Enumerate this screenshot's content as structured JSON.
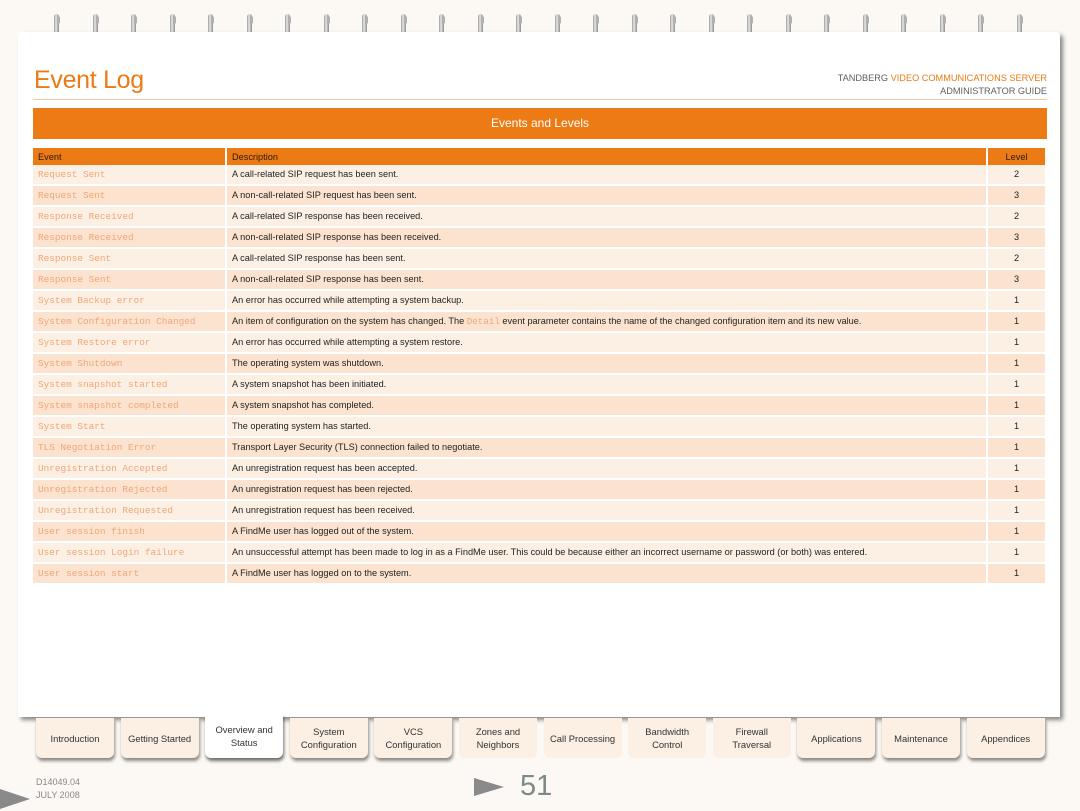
{
  "header": {
    "title": "Event Log",
    "brand_prefix": "TANDBERG ",
    "brand_highlight": "VIDEO COMMUNICATIONS SERVER",
    "guide": "ADMINISTRATOR GUIDE"
  },
  "section": {
    "title": "Events and Levels"
  },
  "table": {
    "columns": [
      "Event",
      "Description",
      "Level"
    ],
    "rows": [
      {
        "event": "Request Sent",
        "description": "A call-related SIP request has been sent.",
        "level": "2"
      },
      {
        "event": "Request Sent",
        "description": "A non-call-related SIP request has been sent.",
        "level": "3"
      },
      {
        "event": "Response Received",
        "description": "A call-related SIP response has been received.",
        "level": "2"
      },
      {
        "event": "Response Received",
        "description": "A non-call-related SIP response has been received.",
        "level": "3"
      },
      {
        "event": "Response Sent",
        "description": "A call-related SIP response has been sent.",
        "level": "2"
      },
      {
        "event": "Response Sent",
        "description": "A non-call-related SIP response has been sent.",
        "level": "3"
      },
      {
        "event": "System Backup error",
        "description": "An error has occurred while attempting a system backup.",
        "level": "1"
      },
      {
        "event": "System Configuration Changed",
        "description_pre": "An item of configuration on the system has changed.  The ",
        "description_code": "Detail",
        "description_post": " event parameter contains the name of the changed configuration item and its new value.",
        "level": "1"
      },
      {
        "event": "System Restore error",
        "description": "An error has occurred while attempting a system restore.",
        "level": "1"
      },
      {
        "event": "System Shutdown",
        "description": "The operating system was shutdown.",
        "level": "1"
      },
      {
        "event": "System snapshot started",
        "description": "A system snapshot has been initiated.",
        "level": "1"
      },
      {
        "event": "System snapshot completed",
        "description": "A system snapshot has completed.",
        "level": "1"
      },
      {
        "event": "System Start",
        "description": "The operating system has started.",
        "level": "1"
      },
      {
        "event": "TLS Negotiation Error",
        "description": "Transport Layer Security (TLS) connection failed to negotiate.",
        "level": "1"
      },
      {
        "event": "Unregistration Accepted",
        "description": "An unregistration request has been accepted.",
        "level": "1"
      },
      {
        "event": "Unregistration Rejected",
        "description": "An unregistration request has been rejected.",
        "level": "1"
      },
      {
        "event": "Unregistration Requested",
        "description": "An unregistration request has been received.",
        "level": "1"
      },
      {
        "event": "User session finish",
        "description": "A FindMe user has logged out of the system.",
        "level": "1"
      },
      {
        "event": "User session Login failure",
        "description": "An unsuccessful attempt has been made to log in as a FindMe user.  This could be because either an incorrect username or password (or both) was entered.",
        "level": "1"
      },
      {
        "event": "User session start",
        "description": "A FindMe user has logged on to the system.",
        "level": "1"
      }
    ]
  },
  "nav_tabs": [
    {
      "label": "Introduction",
      "active": false
    },
    {
      "label": "Getting Started",
      "active": false
    },
    {
      "label": "Overview and Status",
      "active": true
    },
    {
      "label": "System Configuration",
      "active": false
    },
    {
      "label": "VCS Configuration",
      "active": false
    },
    {
      "label": "Zones and Neighbors",
      "active": false
    },
    {
      "label": "Call Processing",
      "active": false
    },
    {
      "label": "Bandwidth Control",
      "active": false
    },
    {
      "label": "Firewall Traversal",
      "active": false
    },
    {
      "label": "Applications",
      "active": false
    },
    {
      "label": "Maintenance",
      "active": false
    },
    {
      "label": "Appendices",
      "active": false
    }
  ],
  "footer": {
    "doc_id": "D14049.04",
    "date": "JULY 2008",
    "page_number": "51"
  },
  "colors": {
    "accent": "#ec7b16",
    "event_name": "#f0a676",
    "row_light": "#fcf0e4",
    "row_dark": "#fbe3cf"
  }
}
